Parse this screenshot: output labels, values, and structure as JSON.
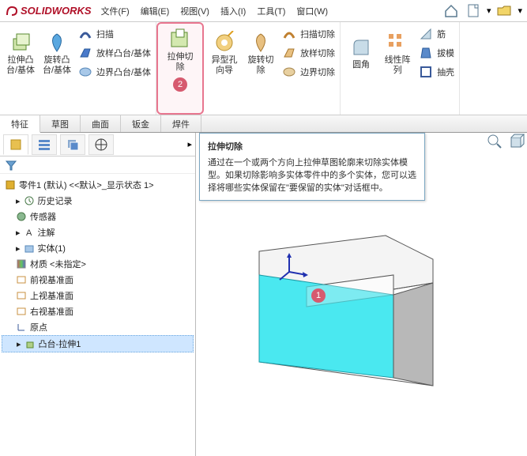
{
  "app": {
    "brand": "SOLIDWORKS"
  },
  "menu": {
    "file": "文件(F)",
    "edit": "编辑(E)",
    "view": "视图(V)",
    "insert": "插入(I)",
    "tool": "工具(T)",
    "window": "窗口(W)"
  },
  "ribbon": {
    "extrude_boss": "拉伸凸台/基体",
    "revolve_boss": "旋转凸台/基体",
    "sweep": "扫描",
    "loft_boss": "放样凸台/基体",
    "boundary_boss": "边界凸台/基体",
    "extruded_cut": "拉伸切除",
    "hole_wizard": "异型孔向导",
    "revolved_cut": "旋转切除",
    "swept_cut": "扫描切除",
    "lofted_cut": "放样切除",
    "boundary_cut": "边界切除",
    "fillet": "圆角",
    "linear_pattern": "线性阵列",
    "rib": "筋",
    "draft": "拔模",
    "shell": "抽壳"
  },
  "tabs": {
    "feature": "特征",
    "sketch": "草图",
    "surface": "曲面",
    "sheetmetal": "钣金",
    "weld": "焊件"
  },
  "tooltip": {
    "title": "拉伸切除",
    "body": "通过在一个或两个方向上拉伸草图轮廓来切除实体模型。如果切除影响多实体零件中的多个实体，您可以选择将哪些实体保留在\"要保留的实体\"对话框中。"
  },
  "tree": {
    "root": "零件1 (默认) <<默认>_显示状态 1>",
    "history": "历史记录",
    "sensors": "传感器",
    "annotations": "注解",
    "solid": "实体(1)",
    "material": "材质 <未指定>",
    "front": "前视基准面",
    "top": "上视基准面",
    "right": "右视基准面",
    "origin": "原点",
    "boss": "凸台-拉伸1"
  },
  "badges": {
    "one": "1",
    "two": "2"
  }
}
